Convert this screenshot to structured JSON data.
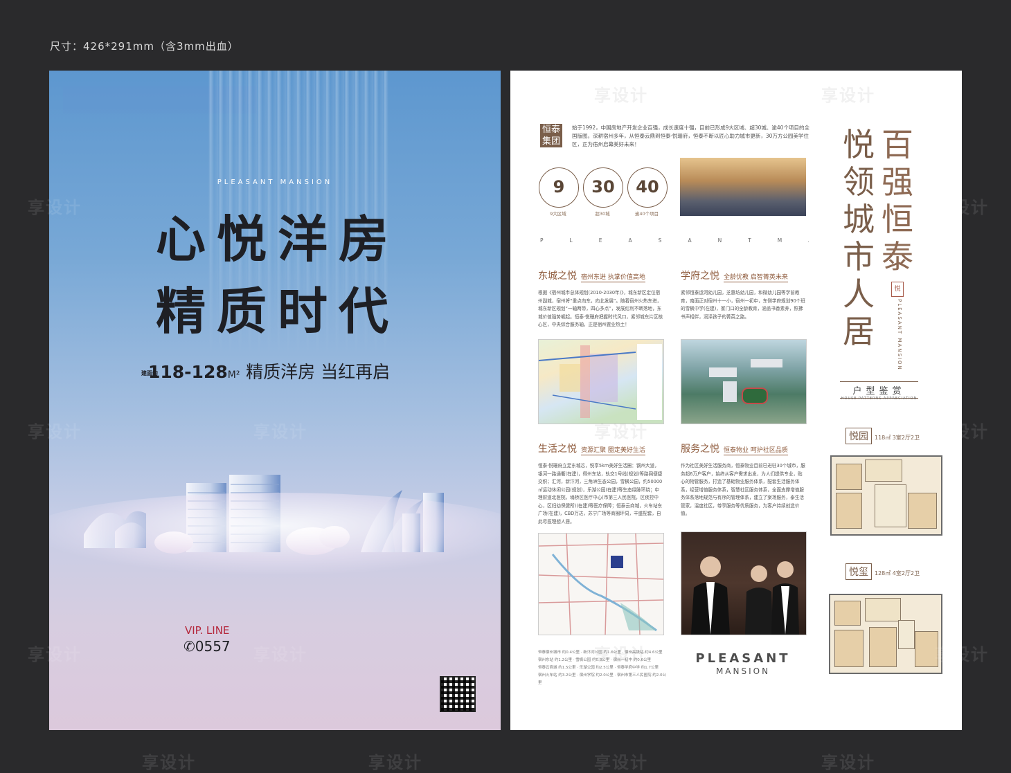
{
  "size_note": "尺寸：426*291mm（含3mm出血）",
  "watermark": "享设计",
  "left": {
    "brand_en": "PLEASANT MANSION",
    "headline_1": "心悦洋房",
    "headline_2": "精质时代",
    "sub_tiny": "建面约",
    "sub_area": "118-128",
    "sub_unit": "M²",
    "sub_text": "精质洋房 当红再启",
    "vip_label": "VIP. LINE",
    "vip_phone": "✆0557"
  },
  "right": {
    "tag": "恒泰集团",
    "intro": "始于1992，中国房地产开发企业百强，成长速度十强，目前已形成9大区域、超30城、逾40个项目的全国版图。深耕宿州多年，从恒泰云鼎到恒泰·悦珊府，恒泰不断以匠心助力城市更新，30万方公园美学住区，正为宿州启幕美好未来！",
    "stats": [
      {
        "num": "9",
        "cap": "9大区域"
      },
      {
        "num": "30",
        "cap": "超30城"
      },
      {
        "num": "40",
        "cap": "逾40个项目"
      }
    ],
    "pm_line": "PLEASANTMANSION",
    "sections": [
      {
        "title": "东城之悦",
        "sub": "宿州东进 执掌价值高地",
        "text": "根据《宿州城市总体规划(2010-2030年)》，城东新区定位宿州副城，宿州将“重点向东，向北发展”。随着宿州火热东进，城东新区规划“一轴两带，四心多点”，发展红利不断落地，东城价值强势崛起。恒泰·悦珊府把握时代风口，紧邻城东片区核心区，中央综合服务轴，正是宿州置业热土！"
      },
      {
        "title": "学府之悦",
        "sub": "全龄优教 启智菁英未来",
        "text": "紧邻恒泰运河幼儿园，芝惠坊幼儿园，和微幼儿园等学前教育，南面正对宿州十一小，宿州一初中，东侧学府规划90个班的雪枫中学(在建)，家门口的全龄教育，涵盖书香素养，照拂书声相伴，润泽孩子的菁英之路。"
      },
      {
        "title": "生活之悦",
        "sub": "资源汇聚 圈定美好生活",
        "text": "恒泰·悦珊府立足东城芯，悦享5km美好生活圈：钢州大道，银河一路通衢(在建)，得州东站，轨交1号线(规划)等路网便捷交织；汇河，新汴河，三角洲生态公园，雪枫公园，约50000㎡运动休闲公园(规划)，乐湖公园(在建)等生态绿脉环绕；中理财道北医院，埇桥区医疗中心(市第三人民医院，区疾控中心，区妇幼保健所)(在建)等医疗保障；恒泰云商城，火车站东广场(在建)，CBD万达，苏宁广场等商圈环伺，丰盛配套，自此尽揽理想人居。"
      },
      {
        "title": "服务之悦",
        "sub": "恒泰物业 呵护社区品质",
        "text": "作为社区美好生活服务商，恒泰物业目前已进驻30个城市，服务超6万户客户，始终从客户需求出发，为人们提供专业，贴心的物管服务，打造了基础物业服务体系，配套生活服务体系，经营增值服务体系，智慧社区服务体系，全面支撑增值服务体系落地规范与有序的管理体系，建立了案场服务，泰生活管家，温度社区，尊享服务等优质服务，为客户持续创造价值。"
      }
    ],
    "pleasant_big_1": "PLEASANT",
    "pleasant_big_2": "MANSION",
    "bus_lines": [
      "恒泰宿州城市 约0.4公里 · 新汴河公园 约1.6公里 · 宿州高铁站 约4.6公里",
      "宿州东站 约1.2公里 · 雪枫公园 约0.8公里 · 宿州一初中 约0.6公里",
      "恒泰云商城 约1.5公里 · 乐湖公园 约2.5公里 · 恒泰学府中学 约1.7公里",
      "宿州火车站 约3.2公里 · 宿州学院 约2.0公里 · 宿州市第三人民医院 约2.0公里"
    ],
    "vert_col1": [
      "悦",
      "领",
      "城",
      "市",
      "人",
      "居"
    ],
    "vert_col2": [
      "百",
      "强",
      "恒",
      "泰"
    ],
    "seal": "悦",
    "vert_en": "PLEASANT MANSION",
    "huxing": "户型鉴赏",
    "huxing_en": "HOUSE PATTERNS APPRECIATION",
    "plans": [
      {
        "name": "悦园",
        "area": "118㎡ 3室2厅2卫"
      },
      {
        "name": "悦玺",
        "area": "128㎡ 4室2厅2卫"
      }
    ]
  }
}
